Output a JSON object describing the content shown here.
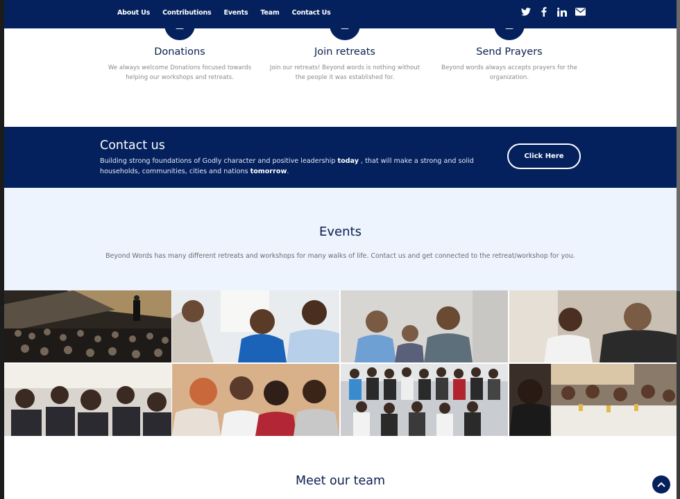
{
  "nav": {
    "links": [
      "About Us",
      "Contributions",
      "Events",
      "Team",
      "Contact Us"
    ],
    "social_icons": [
      "twitter-icon",
      "facebook-icon",
      "linkedin-icon",
      "email-icon"
    ]
  },
  "features": [
    {
      "title": "Donations",
      "text_line1": "We always welcome Donations focused towards",
      "text_line2": "helping our workshops and retreats."
    },
    {
      "title": "Join retreats",
      "text_line1": "Join our retreats! Beyond words is nothing without",
      "text_line2": "the people it was established for."
    },
    {
      "title": "Send Prayers",
      "text_line1": "Beyond words always accepts prayers for the",
      "text_line2": "organization."
    }
  ],
  "contact": {
    "title": "Contact us",
    "text_a": "Building strong foundations of Godly character and positive leadership ",
    "text_bold1": "today",
    "text_b": " , that will make a strong and solid households, communities, cities and nations ",
    "text_bold2": "tomorrow",
    "text_c": ".",
    "button": "Click Here"
  },
  "events": {
    "title": "Events",
    "description": "Beyond Words has many different retreats and workshops for many walks of life. Contact us and get connected to the retreat/workshop for you."
  },
  "team": {
    "title": "Meet our team"
  },
  "colors": {
    "navy": "#04215d",
    "light_blue_bg": "#edf4fd"
  }
}
